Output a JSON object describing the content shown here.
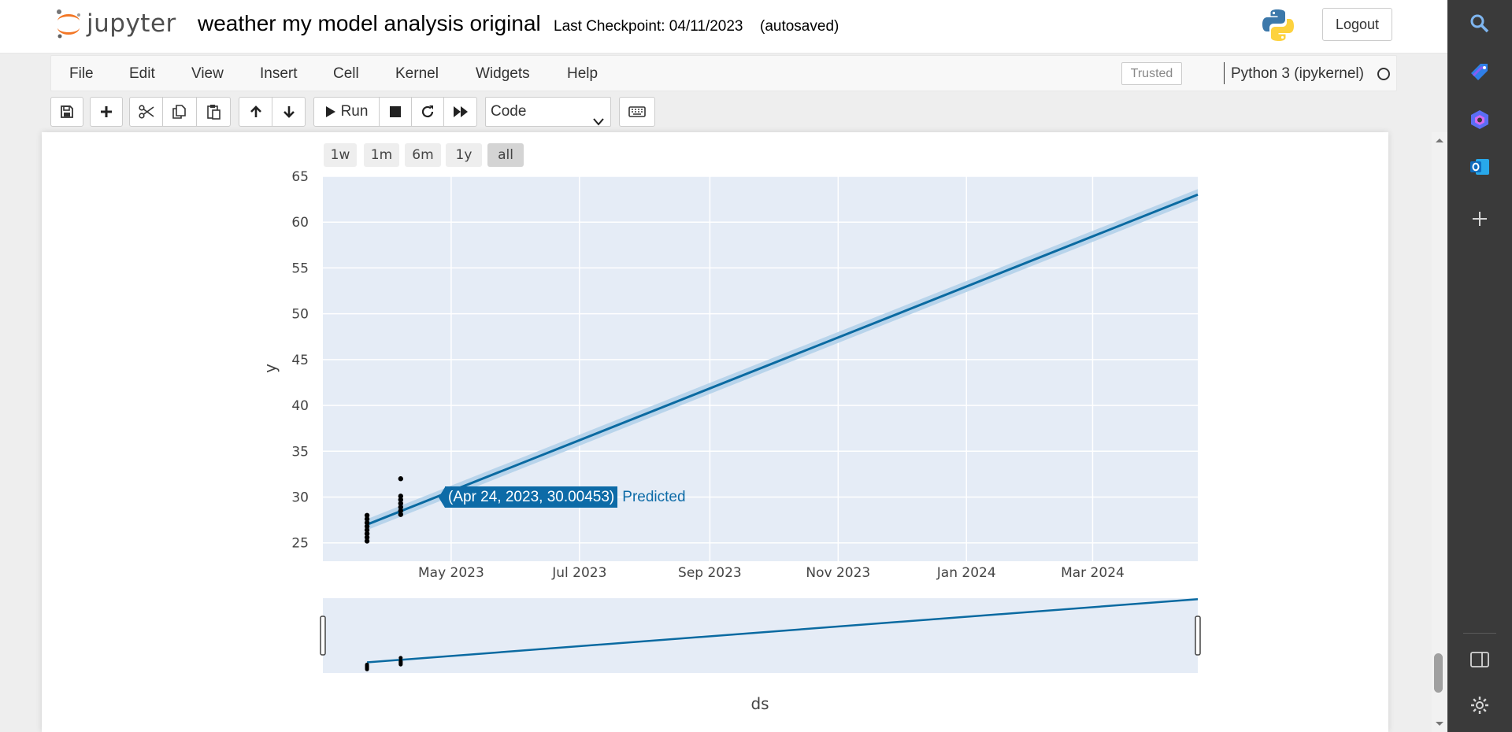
{
  "header": {
    "logo_text": "jupyter",
    "notebook_title": "weather my model analysis original",
    "checkpoint": "Last Checkpoint: 04/11/2023",
    "autosaved": "(autosaved)",
    "logout_label": "Logout"
  },
  "menubar": {
    "items": [
      "File",
      "Edit",
      "View",
      "Insert",
      "Cell",
      "Kernel",
      "Widgets",
      "Help"
    ],
    "trusted": "Trusted",
    "kernel": "Python 3 (ipykernel)"
  },
  "toolbar": {
    "run_label": "Run",
    "cell_type": "Code",
    "cell_type_options": [
      "Code"
    ]
  },
  "chart_data": {
    "type": "line",
    "xlabel": "ds",
    "ylabel": "y",
    "ylim": [
      23,
      65
    ],
    "xlim": [
      "2023-03-01",
      "2024-04-20"
    ],
    "x_ticks": [
      "May 2023",
      "Jul 2023",
      "Sep 2023",
      "Nov 2023",
      "Jan 2024",
      "Mar 2024"
    ],
    "y_ticks": [
      25,
      30,
      35,
      40,
      45,
      50,
      55,
      60,
      65
    ],
    "range_selector": [
      "1w",
      "1m",
      "6m",
      "1y",
      "all"
    ],
    "range_selector_active": "all",
    "rangeslider": true,
    "grid": true,
    "colors": {
      "predicted": "#0a6aa1",
      "band": "#b3d1ea",
      "actual": "#000000",
      "plot_bg": "#e5ecf6"
    },
    "series": [
      {
        "name": "Predicted",
        "x": [
          "2023-03-22",
          "2024-04-20"
        ],
        "y": [
          27.0,
          63.0
        ],
        "upper": [
          27.6,
          63.6
        ],
        "lower": [
          26.4,
          62.4
        ]
      },
      {
        "name": "Actual",
        "type": "scatter",
        "points": [
          [
            "2023-03-22",
            25.2
          ],
          [
            "2023-03-22",
            25.6
          ],
          [
            "2023-03-22",
            26.0
          ],
          [
            "2023-03-22",
            26.4
          ],
          [
            "2023-03-22",
            26.8
          ],
          [
            "2023-03-22",
            27.2
          ],
          [
            "2023-03-22",
            27.6
          ],
          [
            "2023-03-22",
            28.0
          ],
          [
            "2023-04-07",
            28.1
          ],
          [
            "2023-04-07",
            28.5
          ],
          [
            "2023-04-07",
            28.9
          ],
          [
            "2023-04-07",
            29.3
          ],
          [
            "2023-04-07",
            29.7
          ],
          [
            "2023-04-07",
            30.1
          ],
          [
            "2023-04-07",
            32.0
          ]
        ]
      }
    ],
    "hover": {
      "text": "(Apr 24, 2023, 30.00453)",
      "series": "Predicted",
      "x": "2023-04-24",
      "y": 30.00453
    }
  }
}
